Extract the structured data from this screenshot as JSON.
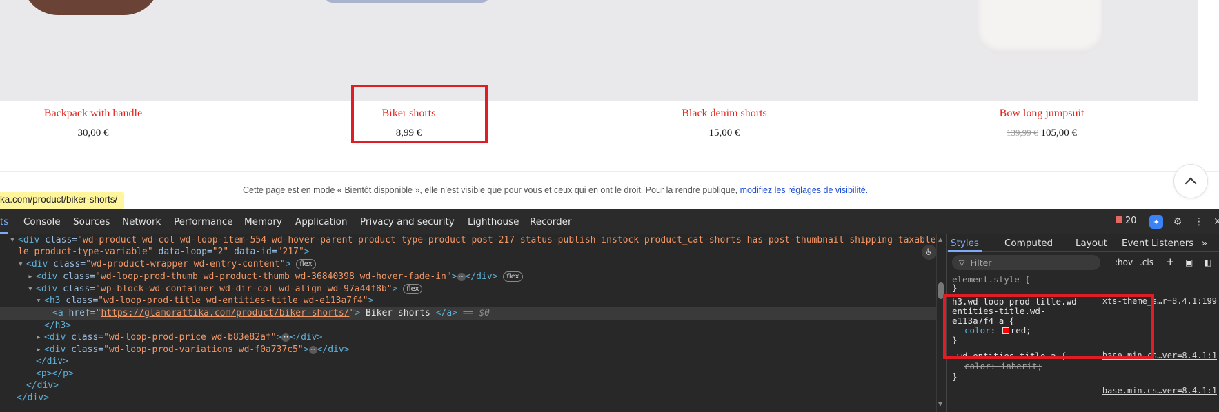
{
  "products": [
    {
      "title": "Backpack with handle",
      "price": "30,00 €"
    },
    {
      "title": "Biker shorts",
      "price": "8,99 €"
    },
    {
      "title": "Black denim shorts",
      "price": "15,00 €"
    },
    {
      "title": "Bow long jumpsuit",
      "old_price": "139,99 €",
      "price": "105,00 €"
    }
  ],
  "notice": {
    "text": "Cette page est en mode « Bientôt disponible », elle n’est visible que pour vous et ceux qui en ont le droit. Pour la rendre publique,",
    "link": "modifiez les réglages de visibilité."
  },
  "url_tooltip": "ka.com/product/biker-shorts/",
  "devtools": {
    "tabs": [
      "ts",
      "Console",
      "Sources",
      "Network",
      "Performance",
      "Memory",
      "Application",
      "Privacy and security",
      "Lighthouse",
      "Recorder"
    ],
    "issues_count": "20",
    "elements": {
      "l1_tag": "<div",
      "l1_attr": " class=",
      "l1_val": "\"wd-product wd-col wd-loop-item-554 wd-hover-parent product type-product post-217 status-publish instock product_cat-shorts has-post-thumbnail shipping-taxable purchasab",
      "l2_val": "le product-type-variable\"",
      "l2_attr1": " data-loop=",
      "l2_val1": "\"2\"",
      "l2_attr2": " data-id=",
      "l2_val2": "\"217\"",
      "l2_end": ">",
      "l3_tag": "<div",
      "l3_attr": " class=",
      "l3_val": "\"wd-product-wrapper wd-entry-content\"",
      "l3_end": ">",
      "l4_tag": "<div",
      "l4_attr": " class=",
      "l4_val": "\"wd-loop-prod-thumb wd-product-thumb wd-36840398 wd-hover-fade-in\"",
      "l4_end": ">",
      "l4_close": "</div>",
      "l5_tag": "<div",
      "l5_attr": " class=",
      "l5_val": "\"wp-block-wd-container wd-dir-col wd-align wd-97a44f8b\"",
      "l5_end": ">",
      "l6_tag": "<h3",
      "l6_attr": " class=",
      "l6_val": "\"wd-loop-prod-title wd-entities-title wd-e113a7f4\"",
      "l6_end": ">",
      "l7_tag": "<a",
      "l7_attr": " href=",
      "l7_href": "https://glamorattika.com/product/biker-shorts/",
      "l7_text": " Biker shorts ",
      "l7_close": "</a>",
      "l7_eq": " == $0",
      "l8": "</h3>",
      "l9_tag": "<div",
      "l9_attr": " class=",
      "l9_val": "\"wd-loop-prod-price wd-b83e82af\"",
      "l9_end": ">",
      "l9_close": "</div>",
      "l10_tag": "<div",
      "l10_attr": " class=",
      "l10_val": "\"wd-loop-prod-variations wd-f0a737c5\"",
      "l10_end": ">",
      "l10_close": "</div>",
      "l11": "</div>",
      "l12": "<p></p>",
      "l13": "</div>",
      "l14": "</div>",
      "badge_flex": "flex",
      "ellipsis": "⋯"
    },
    "styles": {
      "tabs": [
        "Styles",
        "Computed",
        "Layout",
        "Event Listeners",
        "»"
      ],
      "filter_placeholder": "Filter",
      "hov": ":hov",
      "cls": ".cls",
      "rule1_selector": "element.style {",
      "rule1_close": "}",
      "rule2_sel1": "h3.wd-loop-prod-title.wd-",
      "rule2_sel2": "entities-title.wd-",
      "rule2_sel3": "e113a7f4 a {",
      "rule2_src": "xts-theme_s…r=8.4.1:199",
      "rule2_prop": "color",
      "rule2_val": "red;",
      "rule2_close": "}",
      "rule3_selector": ".wd-entities-title a {",
      "rule3_src": "base.min.cs…ver=8.4.1:1",
      "rule3_prop": "color: inherit;",
      "rule3_close": "}",
      "rule4_src": "base.min.cs…ver=8.4.1:1"
    }
  }
}
